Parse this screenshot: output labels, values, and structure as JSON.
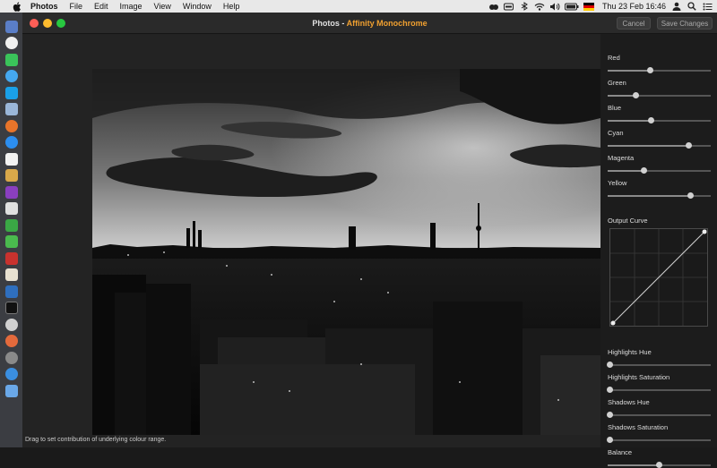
{
  "menubar": {
    "app_name": "Photos",
    "items": [
      "File",
      "Edit",
      "Image",
      "View",
      "Window",
      "Help"
    ],
    "clock": "Thu 23 Feb  16:46",
    "status_icons": [
      "creative-cloud-icon",
      "battery-indicator-icon",
      "bluetooth-icon",
      "wifi-icon",
      "volume-icon",
      "battery-icon",
      "german-flag-icon",
      "user-icon",
      "spotlight-search-icon",
      "notification-list-icon"
    ]
  },
  "window": {
    "title_app": "Photos",
    "title_sep": " - ",
    "title_ext": "Affinity Monochrome",
    "cancel_label": "Cancel",
    "save_label": "Save Changes",
    "hint": "Drag to set contribution of underlying colour range."
  },
  "panel": {
    "sliders": [
      {
        "label": "Red",
        "value": 0.41
      },
      {
        "label": "Green",
        "value": 0.27
      },
      {
        "label": "Blue",
        "value": 0.42
      },
      {
        "label": "Cyan",
        "value": 0.79
      },
      {
        "label": "Magenta",
        "value": 0.35
      },
      {
        "label": "Yellow",
        "value": 0.8
      }
    ],
    "curve_label": "Output Curve",
    "lower_sliders": [
      {
        "label": "Highlights Hue",
        "value": 0.02
      },
      {
        "label": "Highlights Saturation",
        "value": 0.02
      },
      {
        "label": "Shadows Hue",
        "value": 0.02
      },
      {
        "label": "Shadows Saturation",
        "value": 0.02
      },
      {
        "label": "Balance",
        "value": 0.5
      }
    ]
  },
  "colors": {
    "accent": "#f0a030",
    "close": "#fe5f57",
    "minimize": "#febc2e",
    "zoom": "#28c840"
  },
  "dock_apps": [
    "launchpad-icon",
    "itunes-icon",
    "facetime-icon",
    "messages-icon",
    "skype-icon",
    "preview-icon",
    "firefox-icon",
    "safari-icon",
    "calendar-icon",
    "notes-icon",
    "onenote-icon",
    "typora-icon",
    "evernote-icon",
    "numbers-icon",
    "zotero-icon",
    "scrivener-icon",
    "sonos-icon",
    "davinci-icon",
    "chrome-icon",
    "system-preferences-icon",
    "creative-cloud-app-icon",
    "folder-icon",
    "downloads-icon"
  ]
}
